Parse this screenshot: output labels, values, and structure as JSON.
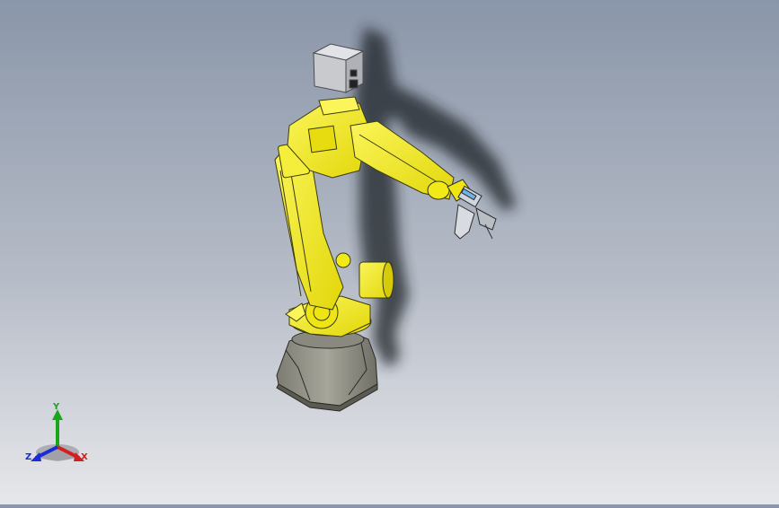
{
  "window": {
    "title": ""
  },
  "model": {
    "name": "robot-arm-assembly",
    "parts": [
      "base-pedestal",
      "turret",
      "lower-arm",
      "elbow",
      "upper-arm",
      "wrist",
      "gripper",
      "controller-box",
      "shadow"
    ]
  },
  "triad": {
    "x_label": "X",
    "y_label": "Y",
    "z_label": "Z"
  },
  "colors": {
    "background_top": "#8a96a9",
    "background_bottom": "#e6e7ea",
    "arm_yellow": "#f2ea18",
    "arm_edge": "#3a3a10",
    "base_gray": "#8f8e83",
    "controller_gray": "#c9cacd",
    "x_axis": "#d22020",
    "y_axis": "#1aa61a",
    "z_axis": "#1b2bd6"
  }
}
